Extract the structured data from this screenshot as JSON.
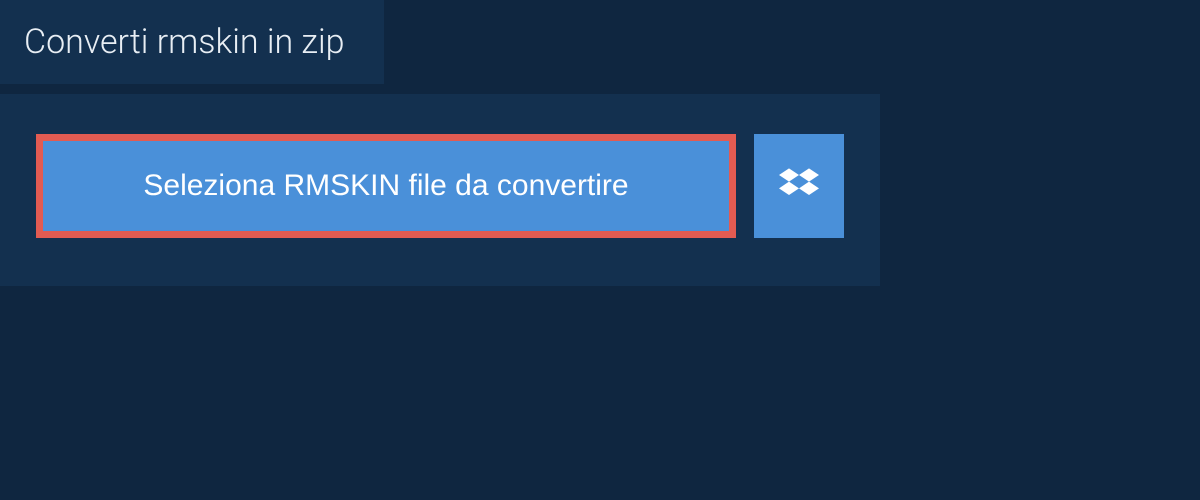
{
  "header": {
    "title": "Converti rmskin in zip"
  },
  "actions": {
    "select_file_label": "Seleziona RMSKIN file da convertire"
  },
  "colors": {
    "background": "#0f2640",
    "panel": "#13304f",
    "button": "#4a90d9",
    "highlight_border": "#e25b52",
    "text": "#ffffff"
  }
}
